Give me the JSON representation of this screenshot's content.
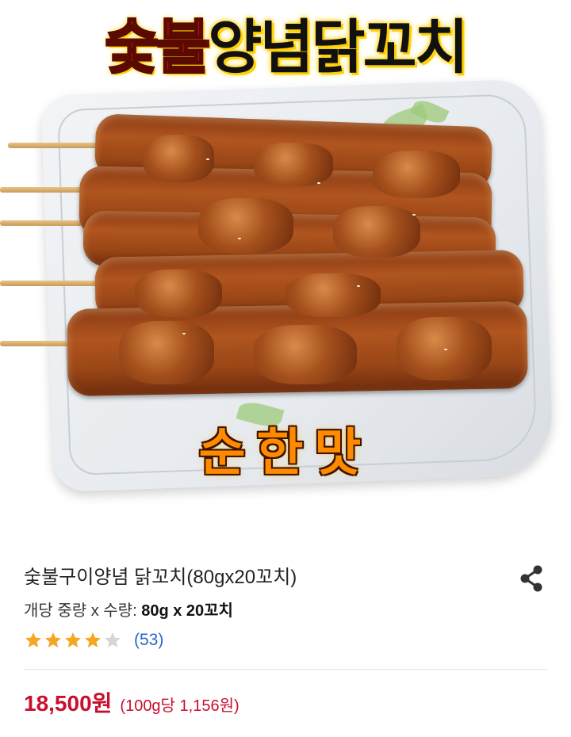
{
  "hero": {
    "title_part1": "숯불",
    "title_part2": "양념닭꼬치",
    "flavor_label": "순한맛"
  },
  "product": {
    "name": "숯불구이양념 닭꼬치(80gx20꼬치)",
    "weight_label": "개당 중량 x 수량:",
    "weight_value": "80g x 20꼬치",
    "rating": 4,
    "rating_max": 5,
    "review_count": "(53)",
    "price": "18,500원",
    "unit_price": "(100g당 1,156원)"
  },
  "icons": {
    "share": "share-icon",
    "star_filled": "star-filled-icon",
    "star_empty": "star-empty-icon"
  },
  "colors": {
    "price": "#c8102e",
    "star_filled": "#f5a623",
    "star_empty": "#d6d6d6",
    "review_link": "#2a66c9"
  }
}
